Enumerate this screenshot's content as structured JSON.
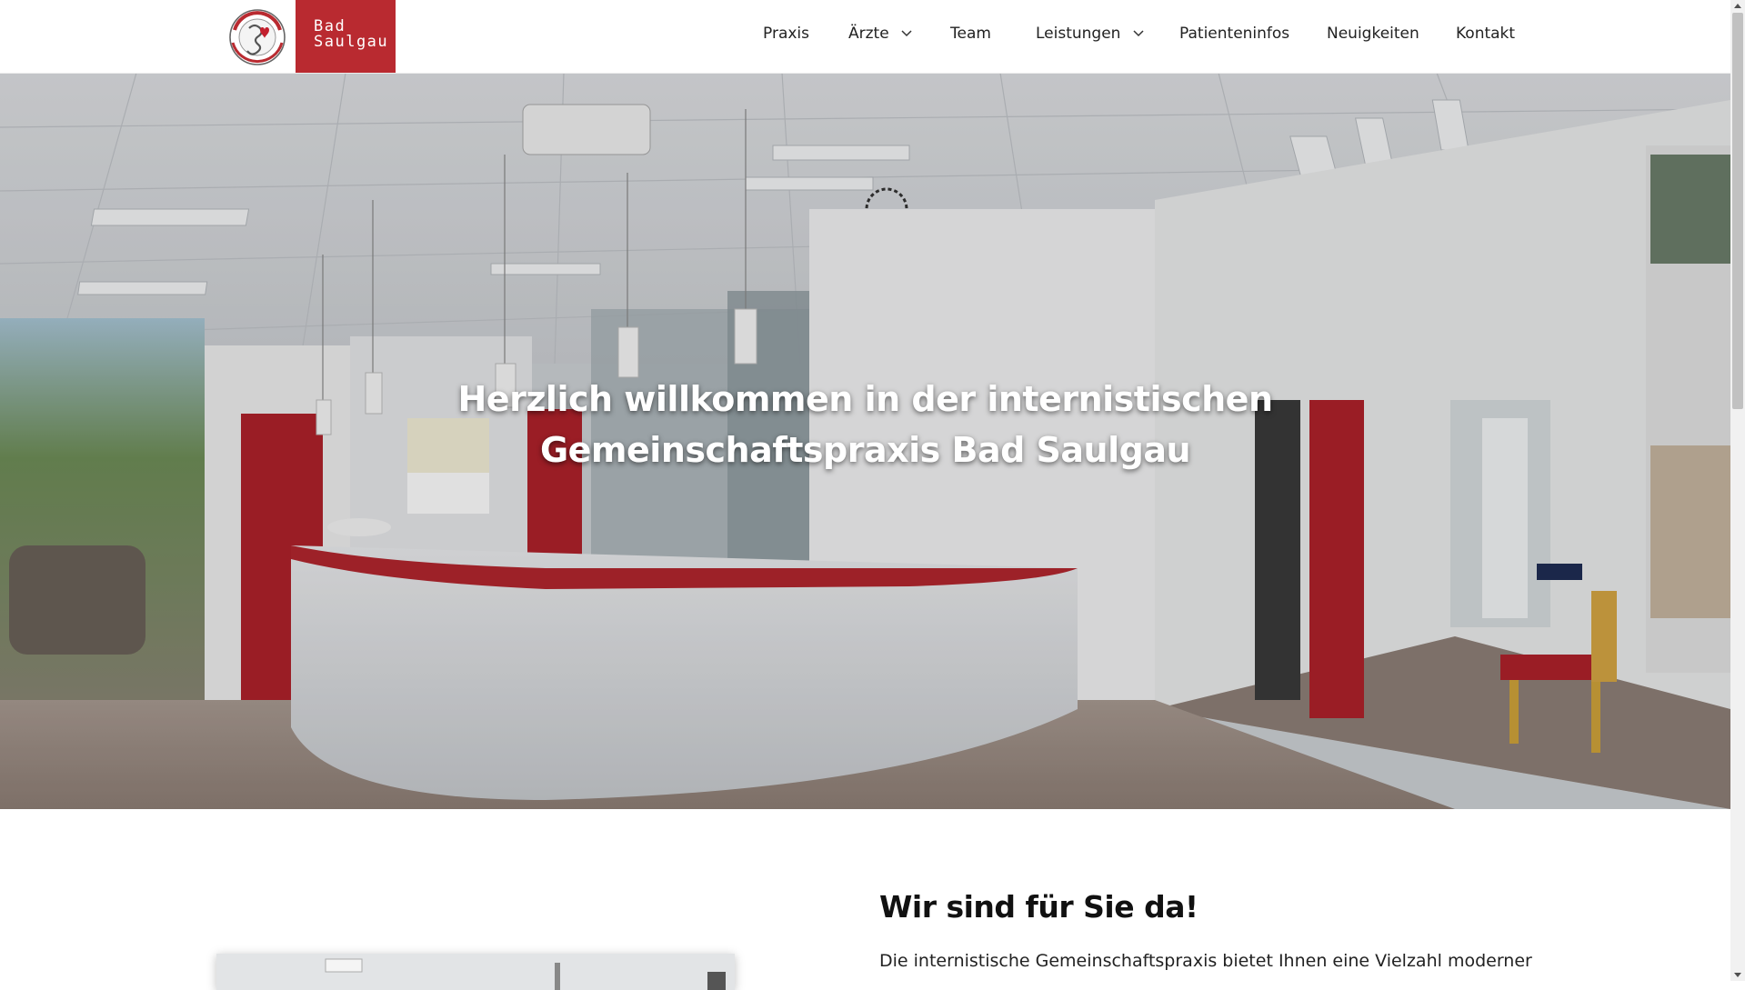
{
  "header": {
    "logo": {
      "emblem_text": "INTERNISTEN Gemeinschaftspraxis",
      "line1": "Bad",
      "line2": "Saulgau",
      "brand_color": "#b92a30"
    },
    "nav": [
      {
        "label": "Praxis",
        "has_dropdown": false
      },
      {
        "label": "Ärzte",
        "has_dropdown": true
      },
      {
        "label": "Team",
        "has_dropdown": false
      },
      {
        "label": "Leistungen",
        "has_dropdown": true
      },
      {
        "label": "Patienteninfos",
        "has_dropdown": false
      },
      {
        "label": "Neuigkeiten",
        "has_dropdown": false
      },
      {
        "label": "Kontakt",
        "has_dropdown": false
      }
    ]
  },
  "hero": {
    "title": "Herzlich willkommen in der internistischen Gemeinschaftspraxis Bad Saulgau"
  },
  "intro": {
    "title": "Wir sind für Sie da!",
    "text": "Die internistische Gemeinschaftspraxis bietet Ihnen eine Vielzahl moderner"
  },
  "icons": {
    "dropdown": "chevron-down-icon"
  }
}
